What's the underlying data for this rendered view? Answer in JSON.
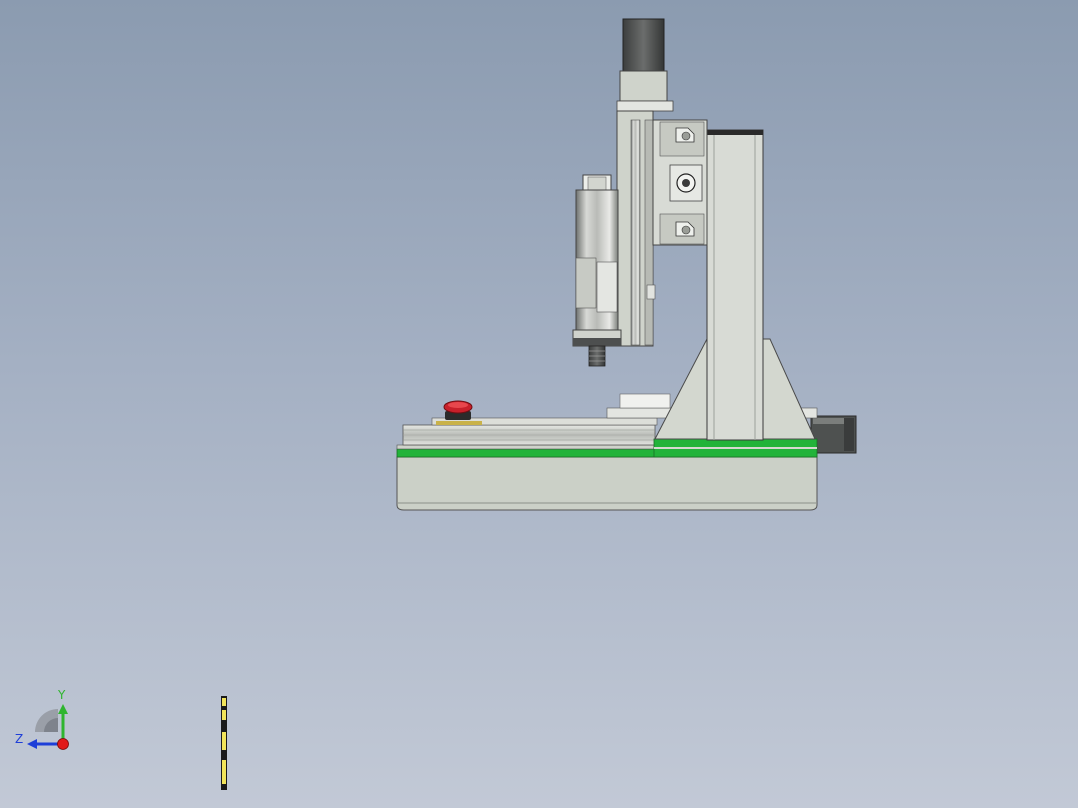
{
  "triad": {
    "y_label": "Y",
    "z_label": "Z",
    "y_color": "#2fb52f",
    "z_color": "#1e3fd8",
    "x_color": "#e11a1a"
  },
  "model": {
    "name_icon": "cnc-router-side-view",
    "accent_green": "#22b33a",
    "estop_color": "#c8202a"
  }
}
